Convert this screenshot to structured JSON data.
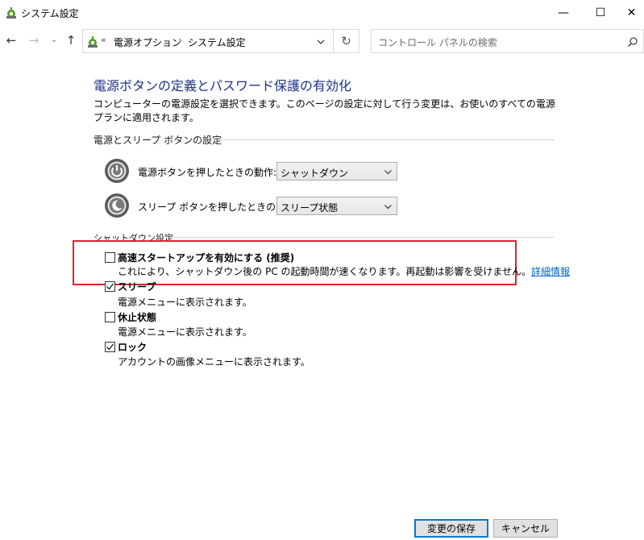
{
  "window": {
    "title": "システム設定",
    "minimize": "—",
    "maximize": "☐",
    "close": "✕"
  },
  "nav": {
    "back": "←",
    "forward": "→",
    "recent": "⌄",
    "up": "↑",
    "address_overflow": "«",
    "breadcrumbs": [
      "電源オプション",
      "システム設定"
    ],
    "breadcrumb_sep": "›",
    "refresh": "↻",
    "search_placeholder": "コントロール パネルの検索"
  },
  "page": {
    "title": "電源ボタンの定義とパスワード保護の有効化",
    "description": "コンピューターの電源設定を選択できます。このページの設定に対して行う変更は、お使いのすべての電源プランに適用されます。"
  },
  "power_buttons": {
    "heading": "電源とスリープ ボタンの設定",
    "rows": [
      {
        "label": "電源ボタンを押したときの動作:",
        "value": "シャットダウン",
        "icon": "power-icon"
      },
      {
        "label": "スリープ ボタンを押したときの動作:",
        "value": "スリープ状態",
        "icon": "sleep-icon"
      }
    ]
  },
  "shutdown": {
    "heading": "シャットダウン設定",
    "options": [
      {
        "title": "高速スタートアップを有効にする (推奨)",
        "desc": "これにより、シャットダウン後の PC の起動時間が速くなります。再起動は影響を受けません。",
        "link": "詳細情報",
        "checked": false
      },
      {
        "title": "スリープ",
        "desc": "電源メニューに表示されます。",
        "checked": true
      },
      {
        "title": "休止状態",
        "desc": "電源メニューに表示されます。",
        "checked": false
      },
      {
        "title": "ロック",
        "desc": "アカウントの画像メニューに表示されます。",
        "checked": true
      }
    ]
  },
  "footer": {
    "save": "変更の保存",
    "cancel": "キャンセル"
  },
  "colors": {
    "title_blue": "#1e3287",
    "link_blue": "#0066cc",
    "highlight_red": "#e0242d"
  }
}
